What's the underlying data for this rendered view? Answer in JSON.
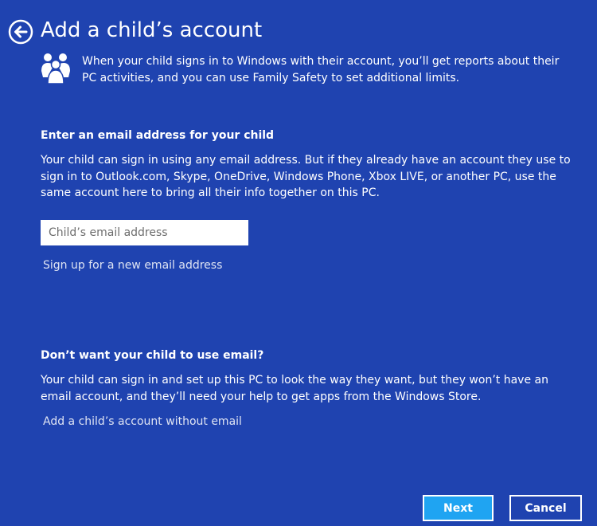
{
  "header": {
    "title": "Add a child’s account",
    "back_icon": "back-arrow-icon"
  },
  "intro": {
    "icon": "family-icon",
    "text": "When your child signs in to Windows with their account, you’ll get reports about their PC activities, and you can use Family Safety to set additional limits."
  },
  "email_section": {
    "heading": "Enter an email address for your child",
    "body": "Your child can sign in using any email address. But if they already have an account they use to sign in to Outlook.com, Skype, OneDrive, Windows Phone, Xbox LIVE, or another PC, use the same account here to bring all their info together on this PC.",
    "input_placeholder": "Child’s email address",
    "input_value": "",
    "signup_link": "Sign up for a new email address"
  },
  "no_email_section": {
    "heading": "Don’t want your child to use email?",
    "body": "Your child can sign in and set up this PC to look the way they want, but they won’t have an email account, and they’ll need your help to get apps from the Windows Store.",
    "link": "Add a child’s account without email"
  },
  "footer": {
    "next_label": "Next",
    "cancel_label": "Cancel"
  },
  "colors": {
    "background": "#1f43b0",
    "next_button": "#1fa4f2",
    "text": "#ffffff"
  }
}
